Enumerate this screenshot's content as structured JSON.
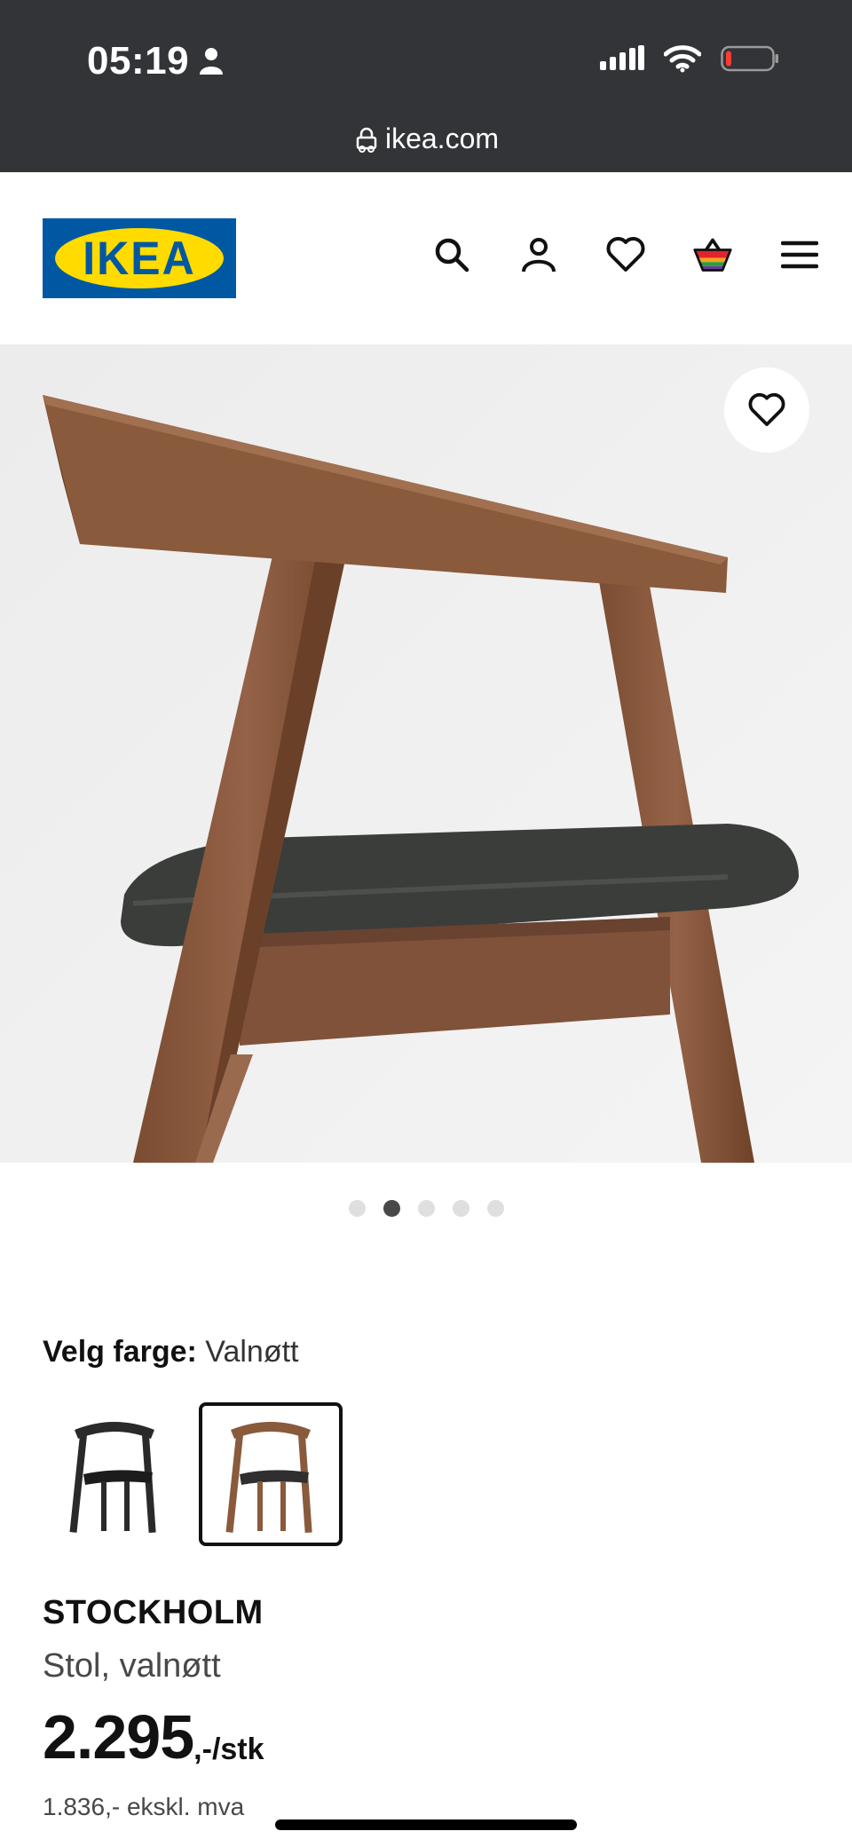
{
  "status_bar": {
    "time": "05:19",
    "url": "ikea.com"
  },
  "header": {
    "logo_text": "IKEA",
    "icons": [
      "search-icon",
      "account-icon",
      "heart-icon",
      "cart-icon",
      "menu-icon"
    ]
  },
  "product_image": {
    "carousel_active_index": 1,
    "carousel_count": 5
  },
  "color_selection": {
    "label": "Velg farge:",
    "value": "Valnøtt",
    "options_selected_index": 1
  },
  "product": {
    "name": "STOCKHOLM",
    "description": "Stol, valnøtt",
    "price_main": "2.295",
    "price_suffix": ",-/stk",
    "price_ex_vat": "1.836,- ekskl. mva"
  },
  "colors": {
    "topbar": "#323438",
    "ikea_blue": "#0058a3",
    "ikea_yellow": "#ffdb00",
    "wood": "#8a5a3c",
    "seat": "#3b3d3b"
  }
}
